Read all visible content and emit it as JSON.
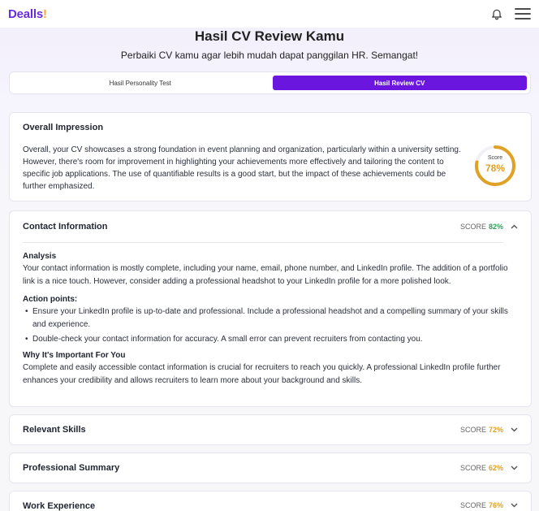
{
  "header": {
    "brand_main": "Dealls",
    "brand_accent": "!"
  },
  "page": {
    "title": "Hasil CV Review Kamu",
    "subtitle": "Perbaiki CV kamu agar lebih mudah dapat panggilan HR. Semangat!"
  },
  "tabs": [
    {
      "label": "Hasil Personality Test",
      "active": false
    },
    {
      "label": "Hasil Review CV",
      "active": true
    }
  ],
  "overall": {
    "title": "Overall Impression",
    "text": "Overall, your CV showcases a strong foundation in event planning and organization, particularly within a university setting. However, there's room for improvement in highlighting your achievements more effectively and tailoring the content to specific job applications. The use of quantifiable results is a good start, but the impact of these achievements could be further emphasized.",
    "score_label": "Score",
    "score_value": "78%",
    "score_fraction": 0.78
  },
  "contact": {
    "title": "Contact Information",
    "score_prefix": "SCORE",
    "score_value": "82%",
    "analysis_title": "Analysis",
    "analysis_text": "Your contact information is mostly complete, including your name, email, phone number, and LinkedIn profile. The addition of a portfolio link is a nice touch. However, consider adding a professional headshot to your LinkedIn profile for a more polished look.",
    "action_title": "Action points:",
    "action_points": [
      "Ensure your LinkedIn profile is up-to-date and professional. Include a professional headshot and a compelling summary of your skills and experience.",
      "Double-check your contact information for accuracy. A small error can prevent recruiters from contacting you."
    ],
    "why_title": "Why It's Important For You",
    "why_text": "Complete and easily accessible contact information is crucial for recruiters to reach you quickly. A professional LinkedIn profile further enhances your credibility and allows recruiters to learn more about your background and skills."
  },
  "sections": [
    {
      "title": "Relevant Skills",
      "score_prefix": "SCORE",
      "score_value": "72%"
    },
    {
      "title": "Professional Summary",
      "score_prefix": "SCORE",
      "score_value": "62%"
    },
    {
      "title": "Work Experience",
      "score_prefix": "SCORE",
      "score_value": "76%"
    }
  ],
  "colors": {
    "brand": "#6a16df",
    "brand_accent": "#f5a623",
    "score_green": "#2f9e5a",
    "score_amber": "#e0a127"
  },
  "icons": {
    "notification": "bell-icon",
    "menu": "hamburger-menu-icon",
    "expand": "chevron-up-icon",
    "collapse": "chevron-down-icon"
  }
}
